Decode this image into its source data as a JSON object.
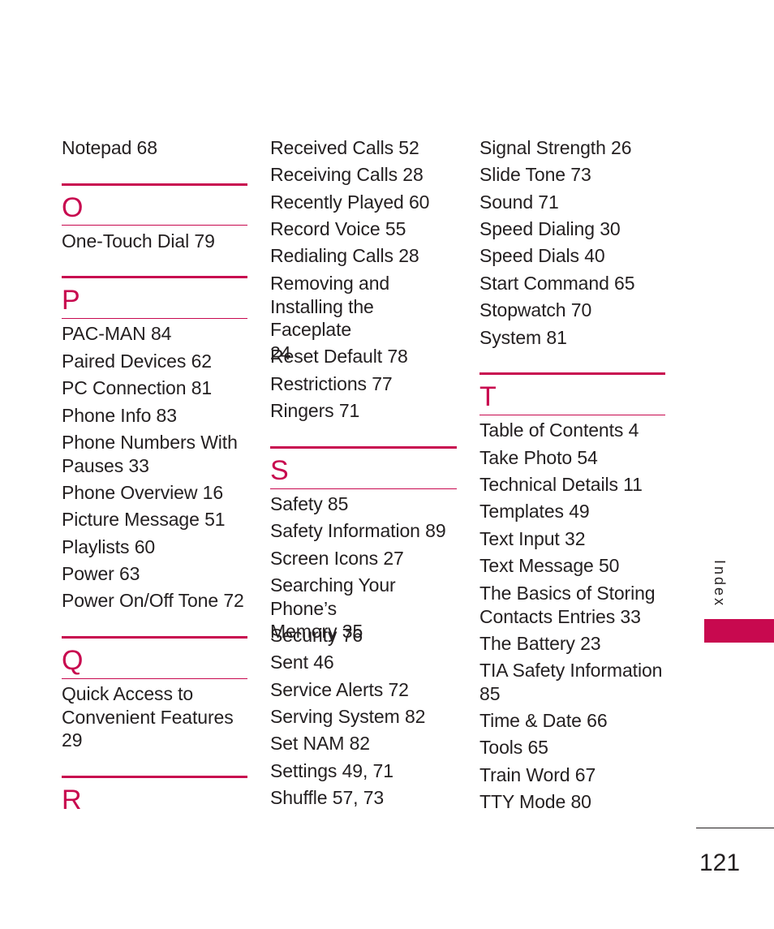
{
  "page": {
    "section_label": "Index",
    "page_number": "121",
    "accent_color": "#c8094f"
  },
  "columns": [
    {
      "blocks": [
        {
          "type": "entries",
          "items": [
            "Notepad 68"
          ]
        },
        {
          "type": "section",
          "letter": "O",
          "items": [
            "One-Touch Dial 79"
          ]
        },
        {
          "type": "section",
          "letter": "P",
          "items": [
            "PAC-MAN 84",
            "Paired Devices 62",
            "PC Connection 81",
            "Phone Info 83",
            "Phone Numbers With\nPauses 33",
            "Phone Overview 16",
            "Picture Message 51",
            "Playlists 60",
            "Power 63",
            "Power On/Off Tone 72"
          ]
        },
        {
          "type": "section",
          "letter": "Q",
          "items": [
            "Quick Access to\nConvenient Features\n29"
          ]
        },
        {
          "type": "section",
          "letter": "R",
          "items": []
        }
      ]
    },
    {
      "blocks": [
        {
          "type": "entries",
          "items": [
            "Received Calls 52",
            "Receiving Calls 28",
            "Recently Played 60",
            "Record Voice 55",
            "Redialing Calls 28",
            "Removing and\nInstalling the Faceplate\n24",
            "Reset Default 78",
            "Restrictions 77",
            "Ringers 71"
          ]
        },
        {
          "type": "section",
          "letter": "S",
          "items": [
            "Safety 85",
            "Safety Information 89",
            "Screen Icons 27",
            "Searching Your Phone’s\nMemory 35",
            "Security 76",
            "Sent 46",
            "Service Alerts 72",
            "Serving System 82",
            "Set NAM 82",
            "Settings 49, 71",
            "Shuffle 57, 73"
          ]
        }
      ]
    },
    {
      "blocks": [
        {
          "type": "entries",
          "items": [
            "Signal Strength 26",
            "Slide Tone 73",
            "Sound 71",
            "Speed Dialing 30",
            "Speed Dials 40",
            "Start Command 65",
            "Stopwatch 70",
            "System 81"
          ]
        },
        {
          "type": "section",
          "letter": "T",
          "items": [
            "Table of Contents 4",
            "Take Photo 54",
            "Technical Details 11",
            "Templates 49",
            "Text Input 32",
            "Text Message 50",
            "The Basics of Storing\nContacts Entries 33",
            "The Battery 23",
            "TIA Safety Information\n85",
            "Time & Date 66",
            "Tools 65",
            "Train Word 67",
            "TTY Mode 80"
          ]
        }
      ]
    }
  ]
}
